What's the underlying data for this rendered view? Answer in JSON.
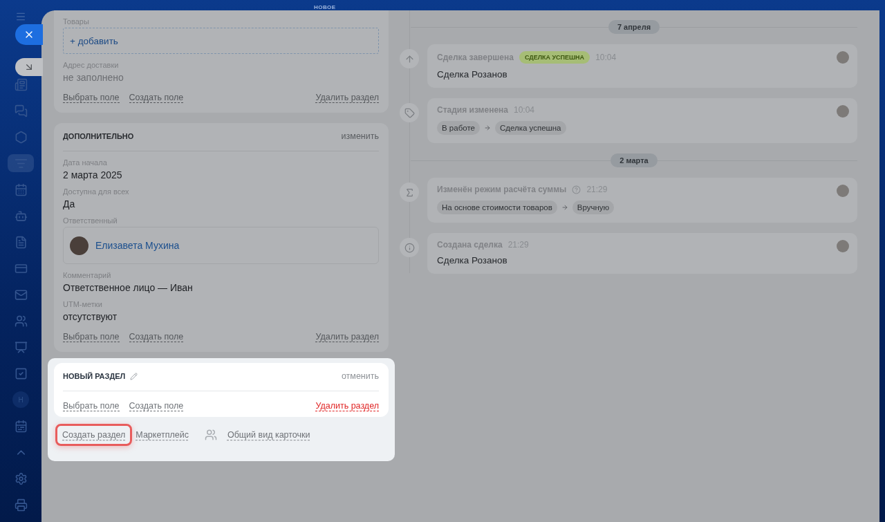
{
  "header": {
    "label": "НОВОЕ"
  },
  "sidebar": {
    "items": [
      {
        "kind": "icon",
        "selected": false
      },
      {
        "kind": "icon",
        "selected": false
      },
      {
        "kind": "icon",
        "selected": false
      },
      {
        "kind": "icon",
        "selected": true
      },
      {
        "kind": "icon",
        "selected": false
      },
      {
        "kind": "icon",
        "selected": false
      },
      {
        "kind": "icon",
        "selected": false
      },
      {
        "kind": "icon",
        "selected": false
      },
      {
        "kind": "icon",
        "selected": false
      },
      {
        "kind": "icon",
        "selected": false
      },
      {
        "kind": "icon",
        "selected": false
      },
      {
        "kind": "icon",
        "selected": false
      },
      {
        "kind": "avatar",
        "text": "Н",
        "selected": false
      },
      {
        "kind": "icon",
        "selected": false
      },
      {
        "kind": "icon",
        "selected": false
      },
      {
        "kind": "icon",
        "selected": false
      },
      {
        "kind": "icon",
        "selected": false
      }
    ]
  },
  "sections": [
    {
      "kind": "dimmed",
      "fields": [
        {
          "kind": "add",
          "label": "Товары",
          "value": "+ добавить"
        },
        {
          "kind": "text",
          "label": "Адрес доставки",
          "value": "не заполнено",
          "empty": true
        }
      ],
      "actions": {
        "select": "Выбрать поле",
        "create": "Создать поле",
        "delete": "Удалить раздел"
      }
    },
    {
      "kind": "dimmed",
      "title": "ДОПОЛНИТЕЛЬНО",
      "title_action": "изменить",
      "fields": [
        {
          "kind": "text",
          "label": "Дата начала",
          "value": "2 марта 2025",
          "empty": false
        },
        {
          "kind": "text",
          "label": "Доступна для всех",
          "value": "Да",
          "empty": false
        },
        {
          "kind": "user",
          "label": "Ответственный",
          "value": "Елизавета Мухина"
        },
        {
          "kind": "text",
          "label": "Комментарий",
          "value": "Ответственное лицо — Иван",
          "empty": false
        },
        {
          "kind": "text",
          "label": "UTM-метки",
          "value": "отсутствуют",
          "empty": false
        }
      ],
      "actions": {
        "select": "Выбрать поле",
        "create": "Создать поле",
        "delete": "Удалить раздел"
      }
    },
    {
      "kind": "new",
      "title": "НОВЫЙ РАЗДЕЛ",
      "title_action": "отменить",
      "actions": {
        "select": "Выбрать поле",
        "create": "Создать поле",
        "delete": "Удалить раздел"
      }
    }
  ],
  "footer_links": [
    {
      "kind": "link",
      "text": "Создать раздел",
      "highlighted": true
    },
    {
      "kind": "link",
      "text": "Маркетплейс",
      "highlighted": false
    },
    {
      "kind": "view",
      "text": "Общий вид карточки",
      "highlighted": false
    }
  ],
  "timeline": [
    {
      "kind": "date",
      "text": "7 апреля"
    },
    {
      "kind": "completed",
      "title": "Сделка завершена",
      "badge": "СДЕЛКА УСПЕШНА",
      "time": "10:04",
      "body": "Сделка Розанов"
    },
    {
      "kind": "stage",
      "title": "Стадия изменена",
      "time": "10:04",
      "chips": [
        "В работе",
        "Сделка успешна"
      ]
    },
    {
      "kind": "date",
      "text": "2 марта"
    },
    {
      "kind": "sum",
      "title": "Изменён режим расчёта суммы",
      "help": true,
      "time": "21:29",
      "chips": [
        "На основе стоимости товаров",
        "Вручную"
      ]
    },
    {
      "kind": "info",
      "title": "Создана сделка",
      "time": "21:29",
      "body": "Сделка Розанов"
    }
  ]
}
